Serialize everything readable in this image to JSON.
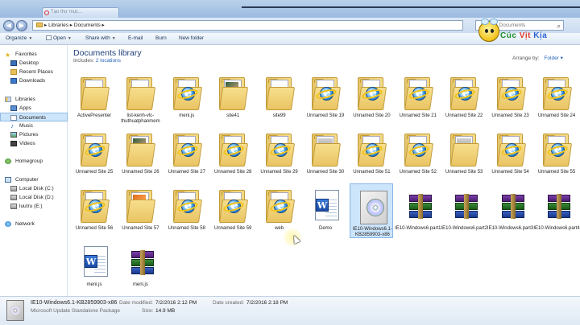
{
  "window": {
    "tab_title": "Tạo thư mục…",
    "back_glyph": "◀",
    "forward_glyph": "▶"
  },
  "address": {
    "crumbs": "▸ Libraries ▸ Documents ▸",
    "search_placeholder": "Search Documents"
  },
  "logo": {
    "part1": "Cúc",
    "part2": "Vịt",
    "part3": "Kịa"
  },
  "toolbar": {
    "organize": "Organize",
    "open": "Open",
    "share_with": "Share with",
    "email": "E-mail",
    "burn": "Burn",
    "new_folder": "New folder"
  },
  "sidebar": {
    "favorites": "Favorites",
    "desktop": "Desktop",
    "recent_places": "Recent Places",
    "downloads": "Downloads",
    "libraries": "Libraries",
    "apps": "Apps",
    "documents": "Documents",
    "music": "Music",
    "pictures": "Pictures",
    "videos": "Videos",
    "homegroup": "Homegroup",
    "computer": "Computer",
    "local_disk_c": "Local Disk (C:)",
    "local_disk_d": "Local Disk (D:)",
    "luutru_e": "luutru (E:)",
    "network": "Network"
  },
  "library": {
    "title": "Documents library",
    "includes_label": "Includes:",
    "includes_link": "2 locations",
    "arrange_label": "Arrange by:",
    "arrange_value": "Folder ▾"
  },
  "items": [
    {
      "label": "ActivePresenter",
      "kind": "folder-doc"
    },
    {
      "label": "list-kenh-vlc-thuthuatphanmem",
      "kind": "folder-doc"
    },
    {
      "label": "meni.js",
      "kind": "folder-ie"
    },
    {
      "label": "site41",
      "kind": "folder-img"
    },
    {
      "label": "site99",
      "kind": "folder"
    },
    {
      "label": "Unnamed Site 19",
      "kind": "folder-ie"
    },
    {
      "label": "Unnamed Site 20",
      "kind": "folder-ie"
    },
    {
      "label": "Unnamed Site 21",
      "kind": "folder-ie"
    },
    {
      "label": "Unnamed Site 22",
      "kind": "folder-ie"
    },
    {
      "label": "Unnamed Site 23",
      "kind": "folder-ie"
    },
    {
      "label": "Unnamed Site 24",
      "kind": "folder-ie"
    },
    {
      "label": "Unnamed Site 25",
      "kind": "folder-ie"
    },
    {
      "label": "Unnamed Site 26",
      "kind": "folder-img"
    },
    {
      "label": "Unnamed Site 27",
      "kind": "folder-ie"
    },
    {
      "label": "Unnamed Site 28",
      "kind": "folder-ie"
    },
    {
      "label": "Unnamed Site 29",
      "kind": "folder-ie"
    },
    {
      "label": "Unnamed Site 30",
      "kind": "folder-gray"
    },
    {
      "label": "Unnamed Site 51",
      "kind": "folder-ie"
    },
    {
      "label": "Unnamed Site 52",
      "kind": "folder-ie"
    },
    {
      "label": "Unnamed Site 53",
      "kind": "folder-gray"
    },
    {
      "label": "Unnamed Site 54",
      "kind": "folder-ie"
    },
    {
      "label": "Unnamed Site 55",
      "kind": "folder-ie"
    },
    {
      "label": "Unnamed Site 56",
      "kind": "folder-ie"
    },
    {
      "label": "Unnamed Site 57",
      "kind": "folder-img2"
    },
    {
      "label": "Unnamed Site 58",
      "kind": "folder-ie"
    },
    {
      "label": "Unnamed Site 59",
      "kind": "folder-ie"
    },
    {
      "label": "web",
      "kind": "folder-ie"
    },
    {
      "label": "Demo",
      "kind": "word"
    },
    {
      "label": "IE10-Windows6.1-KB2859903-x86",
      "kind": "cd",
      "selected": true
    },
    {
      "label": "IE10-Windows6.part1",
      "kind": "rar"
    },
    {
      "label": "IE10-Windows6.part2",
      "kind": "rar"
    },
    {
      "label": "IE10-Windows6.part3",
      "kind": "rar"
    },
    {
      "label": "IE10-Windows6.part4",
      "kind": "rar"
    },
    {
      "label": "meni.js",
      "kind": "word"
    },
    {
      "label": "meni.js",
      "kind": "rar"
    }
  ],
  "details": {
    "filename": "IE10-Windows6.1-KB2859903-x86",
    "type": "Microsoft Update Standalone Package",
    "modified_label": "Date modified:",
    "modified_value": "7/2/2016 2:12 PM",
    "size_label": "Size:",
    "size_value": "14.9 MB",
    "created_label": "Date created:",
    "created_value": "7/2/2016 2:18 PM"
  }
}
